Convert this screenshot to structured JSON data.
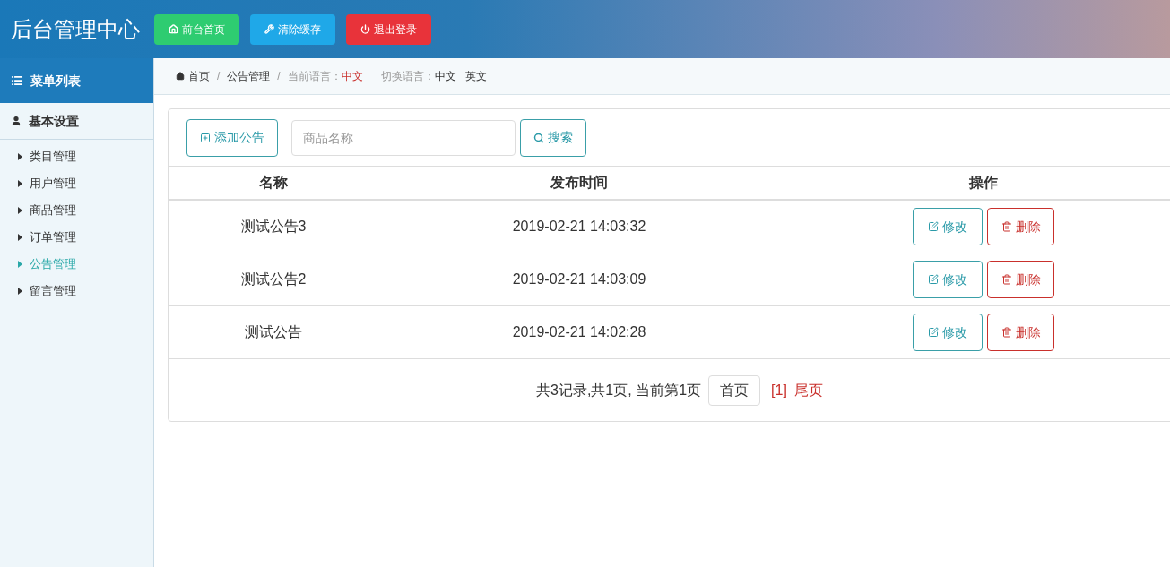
{
  "header": {
    "title": "后台管理中心",
    "buttons": [
      {
        "label": "前台首页",
        "kind": "home"
      },
      {
        "label": "清除缓存",
        "kind": "clear"
      },
      {
        "label": "退出登录",
        "kind": "logout"
      }
    ]
  },
  "sidebar": {
    "heading": "菜单列表",
    "section": "基本设置",
    "items": [
      {
        "label": "类目管理",
        "selected": false
      },
      {
        "label": "用户管理",
        "selected": false
      },
      {
        "label": "商品管理",
        "selected": false
      },
      {
        "label": "订单管理",
        "selected": false
      },
      {
        "label": "公告管理",
        "selected": true
      },
      {
        "label": "留言管理",
        "selected": false
      }
    ]
  },
  "breadcrumb": {
    "separator": "/",
    "items": [
      "首页",
      "公告管理"
    ],
    "language_label": "当前语言：",
    "language": "中文",
    "switch_label": "切换语言：",
    "switch_options": [
      "中文",
      "英文"
    ]
  },
  "toolbar": {
    "add_button": "添加公告",
    "search": {
      "placeholder": "商品名称"
    },
    "search_button": "搜索"
  },
  "table": {
    "columns": [
      "名称",
      "发布时间",
      "操作"
    ],
    "rows": [
      {
        "name": "测试公告3",
        "time": "2019-02-21 14:03:32",
        "actions": [
          "修改",
          "删除"
        ]
      },
      {
        "name": "测试公告2",
        "time": "2019-02-21 14:03:09",
        "actions": [
          "修改",
          "删除"
        ]
      },
      {
        "name": "测试公告",
        "time": "2019-02-21 14:02:28",
        "actions": [
          "修改",
          "删除"
        ]
      }
    ]
  },
  "pagination": {
    "summary": "共3记录,共1页, 当前第1页",
    "first": "首页",
    "current": "[1]",
    "last": "尾页"
  }
}
